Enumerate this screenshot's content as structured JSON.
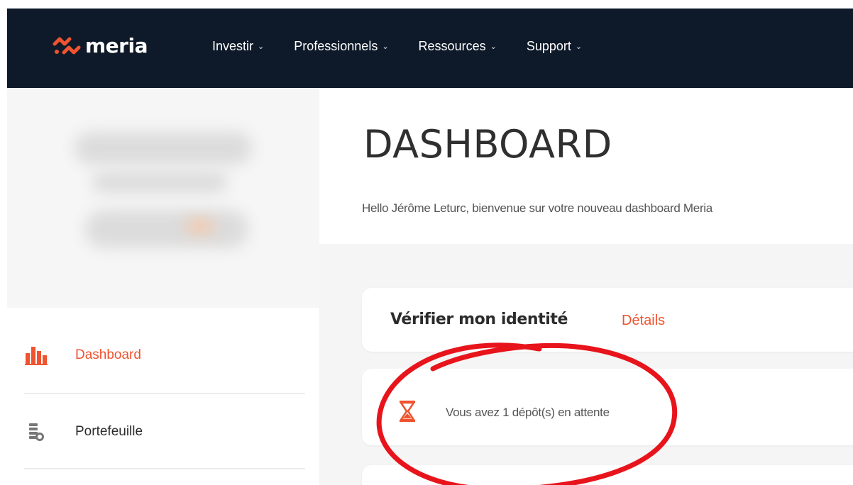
{
  "brand": {
    "name": "meria",
    "accent": "#f0532f",
    "nav_bg": "#0e1a29"
  },
  "nav": {
    "items": [
      {
        "label": "Investir",
        "chevron": "chevron-down-icon"
      },
      {
        "label": "Professionnels",
        "chevron": "chevron-down-icon"
      },
      {
        "label": "Ressources",
        "chevron": "chevron-down-icon"
      },
      {
        "label": "Support",
        "chevron": "chevron-down-icon"
      }
    ]
  },
  "sidebar": {
    "items": [
      {
        "label": "Dashboard",
        "icon": "bar-chart-icon",
        "active": true
      },
      {
        "label": "Portefeuille",
        "icon": "coins-wallet-icon",
        "active": false
      }
    ]
  },
  "main": {
    "title": "DASHBOARD",
    "greeting": "Hello Jérôme Leturc, bienvenue sur votre nouveau dashboard Meria",
    "identity_card": {
      "title": "Vérifier mon identité",
      "link": "Détails"
    },
    "deposit_card": {
      "text": "Vous avez 1 dépôt(s) en attente",
      "icon": "hourglass-icon"
    }
  },
  "annotation": {
    "color": "#e8141c",
    "shape": "circle"
  }
}
